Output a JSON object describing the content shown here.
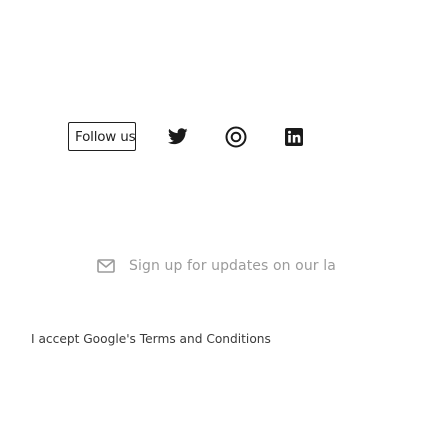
{
  "follow": {
    "label": "Follow us"
  },
  "social": {
    "icons": [
      "twitter-icon",
      "instagram-icon",
      "linkedin-icon"
    ]
  },
  "signup": {
    "icon": "mail-icon",
    "text": "Sign up for updates on our la"
  },
  "consent": {
    "text": "I accept Google's Terms and Conditions"
  },
  "colors": {
    "text_dark": "#1f1f1f",
    "text_muted": "#9b9b9b",
    "background": "#ffffff"
  }
}
